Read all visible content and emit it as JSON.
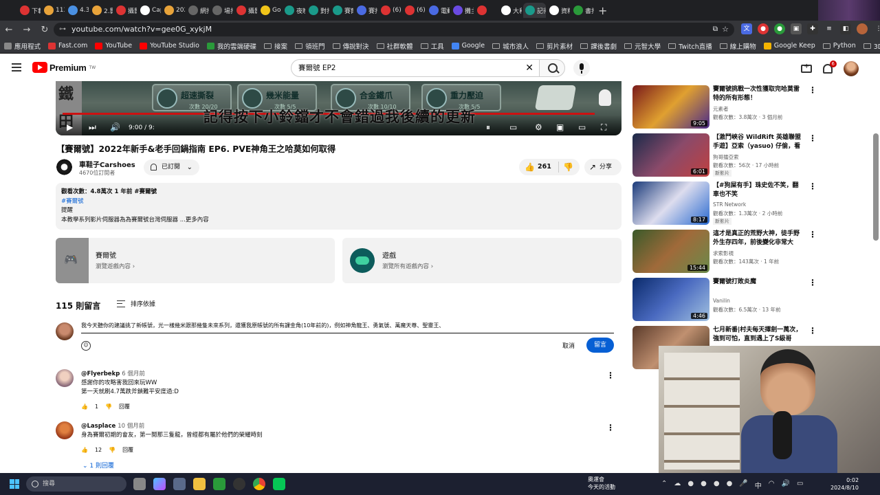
{
  "browser": {
    "tabs": [
      {
        "label": "下載",
        "color": "#d33"
      },
      {
        "label": "113",
        "color": "#e8a33a"
      },
      {
        "label": "4.3",
        "color": "#4a90e2"
      },
      {
        "label": "2.影",
        "color": "#e8a33a"
      },
      {
        "label": "攝影",
        "color": "#d33"
      },
      {
        "label": "Cap",
        "color": "#fff"
      },
      {
        "label": "202",
        "color": "#e8a33a"
      },
      {
        "label": "網打",
        "color": "#666"
      },
      {
        "label": "場打",
        "color": "#666"
      },
      {
        "label": "攝影",
        "color": "#d33"
      },
      {
        "label": "Go",
        "color": "#f0c419"
      },
      {
        "label": "夜晚",
        "color": "#1a9a8a"
      },
      {
        "label": "對打",
        "color": "#1a9a8a"
      },
      {
        "label": "賽爾",
        "color": "#1a9a8a"
      },
      {
        "label": "賽打",
        "color": "#4a6ae2"
      },
      {
        "label": "(6)",
        "color": "#d33"
      },
      {
        "label": "(6)",
        "color": "#d33"
      },
      {
        "label": "電動",
        "color": "#4a6ae2"
      },
      {
        "label": "攤主",
        "color": "#6a4ae2"
      },
      {
        "label": "",
        "color": "#d33"
      },
      {
        "label": "大和",
        "color": "#fff"
      },
      {
        "label": "記得",
        "color": "#1a9a8a"
      },
      {
        "label": "資料",
        "color": "#fff"
      },
      {
        "label": "書打",
        "color": "#2a9a3a"
      }
    ],
    "new_tab": "+",
    "url": "youtube.com/watch?v=gee0G_xykjM",
    "bookmarks": [
      {
        "label": "應用程式",
        "color": "#888"
      },
      {
        "label": "Fast.com",
        "color": "#d33"
      },
      {
        "label": "YouTube",
        "color": "#f00"
      },
      {
        "label": "YouTube Studio",
        "color": "#f00"
      },
      {
        "label": "我的雲端硬碟",
        "color": "#2a9a3a"
      },
      {
        "label": "接案",
        "color": ""
      },
      {
        "label": "領班門",
        "color": ""
      },
      {
        "label": "傳說對決",
        "color": ""
      },
      {
        "label": "社群軟體",
        "color": ""
      },
      {
        "label": "工具",
        "color": ""
      },
      {
        "label": "Google",
        "color": "#4285f4"
      },
      {
        "label": "城市浪人",
        "color": ""
      },
      {
        "label": "剪片素材",
        "color": ""
      },
      {
        "label": "課後書劇",
        "color": ""
      },
      {
        "label": "元智大學",
        "color": ""
      },
      {
        "label": "Twitch直播",
        "color": ""
      },
      {
        "label": "線上購物",
        "color": ""
      },
      {
        "label": "Google Keep",
        "color": "#f4b400"
      },
      {
        "label": "Python",
        "color": ""
      },
      {
        "label": "3D建模",
        "color": ""
      }
    ]
  },
  "header": {
    "logo_text": "Premium",
    "logo_sup": "TW",
    "search_value": "賽爾號 EP2",
    "notification_count": "6"
  },
  "player": {
    "cards": [
      {
        "title": "超速撕裂",
        "sub": "次數 20/20"
      },
      {
        "title": "幾米能量",
        "sub": "次數 5/5"
      },
      {
        "title": "合金鐵爪",
        "sub": "次數 10/10"
      },
      {
        "title": "重力壓迫",
        "sub": "次數 5/5"
      }
    ],
    "subtitle": "記得按下小鈴鐺才不會錯過我後續的更新",
    "time": "9:00 / 9:",
    "progress": 0.97
  },
  "video": {
    "title": "【賽爾號】2022年新手&老手回鍋指南 EP6. PVE神角王之哈莫如何取得",
    "channel": "車鞋子Carshoes",
    "subscribers": "4670位訂閱者",
    "subscribed_label": "已訂閱",
    "likes": "261",
    "share_label": "分享",
    "desc_meta": "觀看次數：4.8萬次  1 年前  #賽爾號",
    "desc_tag": "#賽爾號",
    "desc_line1": "提醒",
    "desc_line2": "本教學系列影片伺服器為為賽爾號台灣伺服器 ...更多內容"
  },
  "game_cards": [
    {
      "title": "賽爾號",
      "sub": "瀏覽遊戲內容 ›"
    },
    {
      "title": "遊戲",
      "sub": "瀏覽所有遊戲內容 ›"
    }
  ],
  "comments_section": {
    "count": "115 則留言",
    "sort_label": "排序依據",
    "draft": "我今天聽你的建議挑了新帳號，光一樣幾米跟那幾隻未來系列，還獲我原帳號的所有課金角(10年前的)，例如神角龍王、勇氣號、萬魔天尊、聖靈王、",
    "cancel": "取消",
    "post": "留言",
    "items": [
      {
        "author": "@Flyerbekp",
        "time": "6 個月前",
        "lines": [
          "感謝你的攻略害我回來玩WW",
          "第一天就刷4.7萬跌斧鎖難平安度過:D"
        ],
        "likes": "1",
        "reply": "回覆"
      },
      {
        "author": "@Lasplace",
        "time": "10 個月前",
        "lines": [
          "身為賽爾初期的會友，第一鬩那三隻龍，曾經都有屬於他們的榮耀時刻"
        ],
        "likes": "12",
        "reply": "回覆"
      }
    ],
    "replies_label": "1 則回覆"
  },
  "sidebar": [
    {
      "title": "賽爾號挑戰一次性獲取完哈莫雷特的所有形態！",
      "channel": "元素者",
      "meta": "觀看次數：3.8萬次 · 3 個月前",
      "duration": "9:05",
      "new": ""
    },
    {
      "title": "【激鬥峽谷 WildRift 英雄聯盟手遊】亞索（yasuo) 仔偷，看波波",
      "channel": "狗哥擂亞索",
      "meta": "觀看次數：56次 · 17 小時前",
      "duration": "6:01",
      "new": "新影片"
    },
    {
      "title": "【#狗屎有手】珠史佐不笑，翻車也不笑",
      "channel": "STR Network",
      "meta": "觀看次數：1.3萬次 · 2 小時前",
      "duration": "8:17",
      "new": "新影片"
    },
    {
      "title": "這才是真正的荒野大神，徒手野外生存四年，前後變化非常大#...",
      "channel": "求索影視",
      "meta": "觀看次數：143萬次 · 1 年前",
      "duration": "15:44",
      "new": ""
    },
    {
      "title": "賽爾號打敗炎魔",
      "channel": "Vanilin",
      "meta": "觀看次數：6.5萬次 · 13 年前",
      "duration": "4:46",
      "new": ""
    },
    {
      "title": "七月新番|村夫每天擇劍一萬次，強到可怕，直到遇上了S級哥布...",
      "channel": "",
      "meta": "",
      "duration": "",
      "new": ""
    }
  ],
  "taskbar": {
    "search_placeholder": "搜尋",
    "notice_title": "奧運會",
    "notice_sub": "今天的活動",
    "ime": "中",
    "time": "0:02",
    "date": "2024/8/10"
  }
}
